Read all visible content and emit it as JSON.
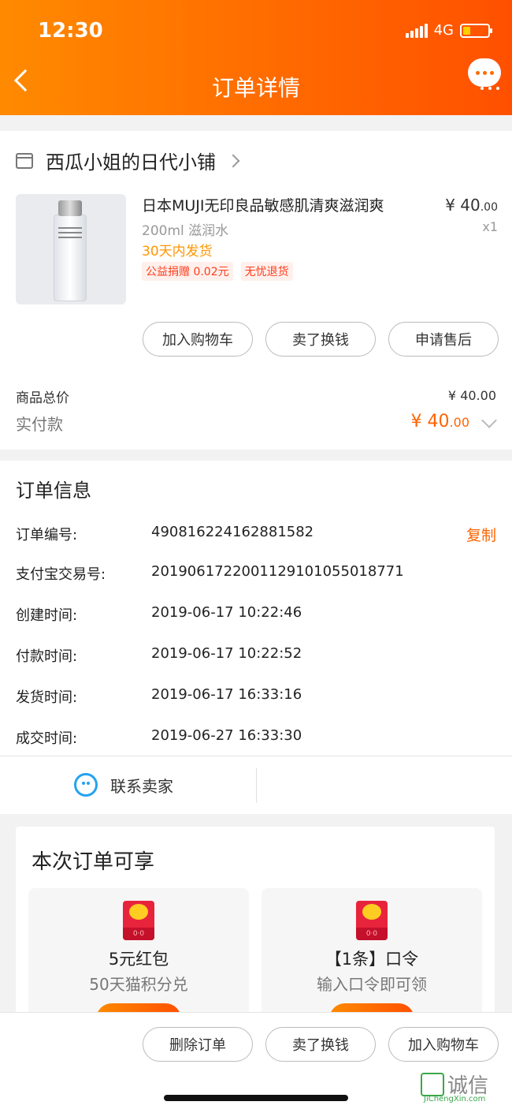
{
  "status_bar": {
    "time": "12:30",
    "network": "4G",
    "battery_level": 0.3
  },
  "header": {
    "title": "订单详情",
    "back_icon": "chevron-left-icon",
    "more_icon": "chat-bubble-icon"
  },
  "shop": {
    "name": "西瓜小姐的日代小铺"
  },
  "product": {
    "name": "日本MUJI无印良品敏感肌清爽滋润爽",
    "spec": "200ml 滋润水",
    "price_int": "¥ 40",
    "price_dec": ".00",
    "quantity": "x1",
    "shipping": "30天内发货",
    "tags": [
      "公益捐赠 0.02元",
      "无忧退货"
    ]
  },
  "item_actions": {
    "add_cart": "加入购物车",
    "sell": "卖了换钱",
    "after_sale": "申请售后"
  },
  "summary": {
    "total_label": "商品总价",
    "total_value": "¥ 40.00",
    "paid_label": "实付款",
    "paid_int": "¥ 40",
    "paid_dec": ".00"
  },
  "order_info": {
    "title": "订单信息",
    "copy_label": "复制",
    "rows": [
      {
        "label": "订单编号:",
        "value": "490816224162881582"
      },
      {
        "label": "支付宝交易号:",
        "value": "2019061722001129101055018771"
      },
      {
        "label": "创建时间:",
        "value": "2019-06-17 10:22:46"
      },
      {
        "label": "付款时间:",
        "value": "2019-06-17 10:22:52"
      },
      {
        "label": "发货时间:",
        "value": "2019-06-17 16:33:16"
      },
      {
        "label": "成交时间:",
        "value": "2019-06-27 16:33:30"
      }
    ],
    "contact_label": "联系卖家"
  },
  "benefits": {
    "title": "本次订单可享",
    "items": [
      {
        "name": "5元红包",
        "desc": "50天猫积分兑"
      },
      {
        "name": "【1条】口令",
        "desc": "输入口令即可领"
      }
    ]
  },
  "bottom_actions": {
    "delete": "删除订单",
    "sell": "卖了换钱",
    "add_cart": "加入购物车"
  },
  "watermark": {
    "text": "诚信",
    "sub": "JiChengXin.com"
  },
  "colors": {
    "accent": "#ff5000",
    "accent_light": "#ff8a00",
    "price": "#ff6400",
    "ship": "#ff9500"
  }
}
